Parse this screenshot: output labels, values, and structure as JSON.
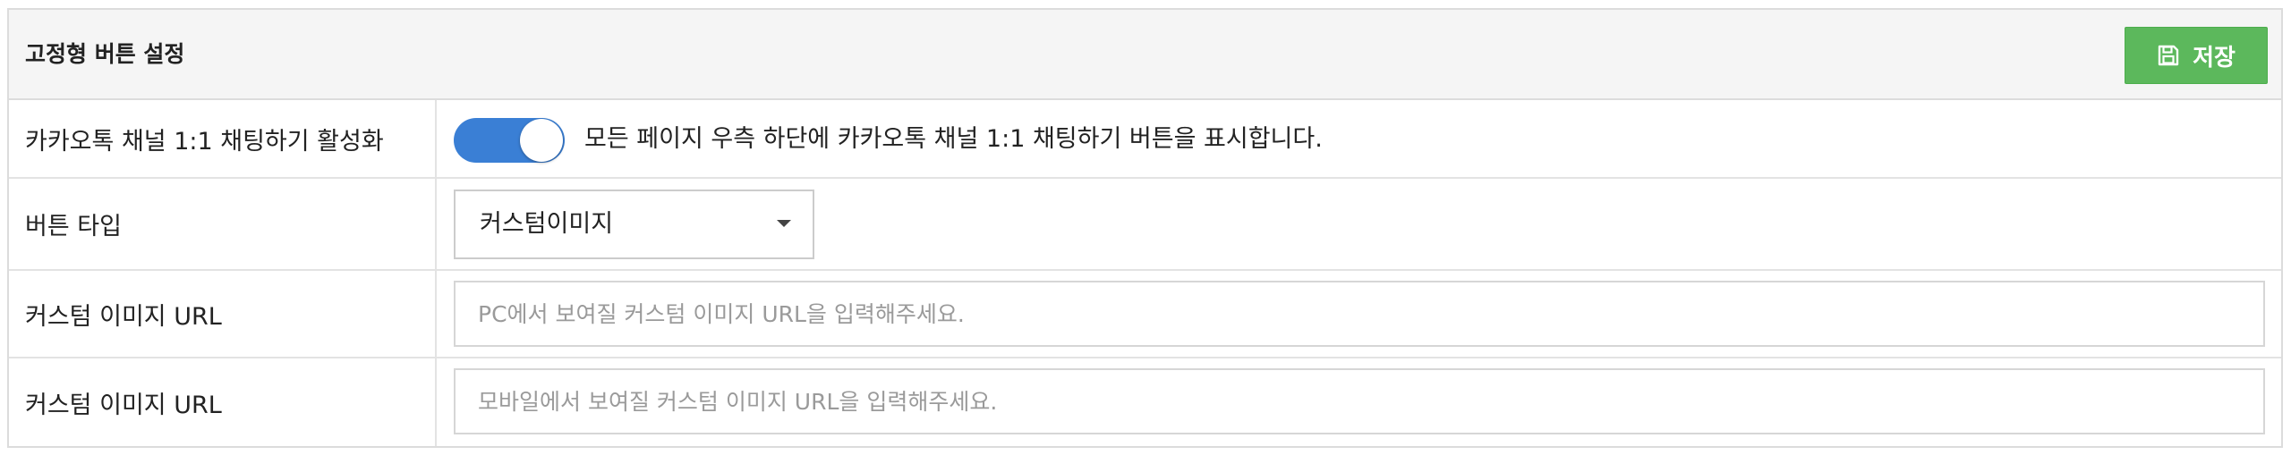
{
  "panel": {
    "title": "고정형 버튼 설정",
    "save_button": {
      "label": "저장",
      "icon": "floppy-disk-icon",
      "color": "#5cb85c"
    }
  },
  "rows": [
    {
      "label": "카카오톡 채널 1:1 채팅하기 활성화",
      "toggle": {
        "on": true,
        "color": "#3a7fd5"
      },
      "description": "모든 페이지 우측 하단에 카카오톡 채널 1:1 채팅하기 버튼을 표시합니다."
    },
    {
      "label": "버튼 타입",
      "select": {
        "value": "커스텀이미지"
      }
    },
    {
      "label": "커스텀 이미지 URL",
      "input": {
        "value": "",
        "placeholder": "PC에서 보여질 커스텀 이미지 URL을 입력해주세요."
      }
    },
    {
      "label": "커스텀 이미지 URL",
      "input": {
        "value": "",
        "placeholder": "모바일에서 보여질 커스텀 이미지 URL을 입력해주세요."
      }
    }
  ]
}
